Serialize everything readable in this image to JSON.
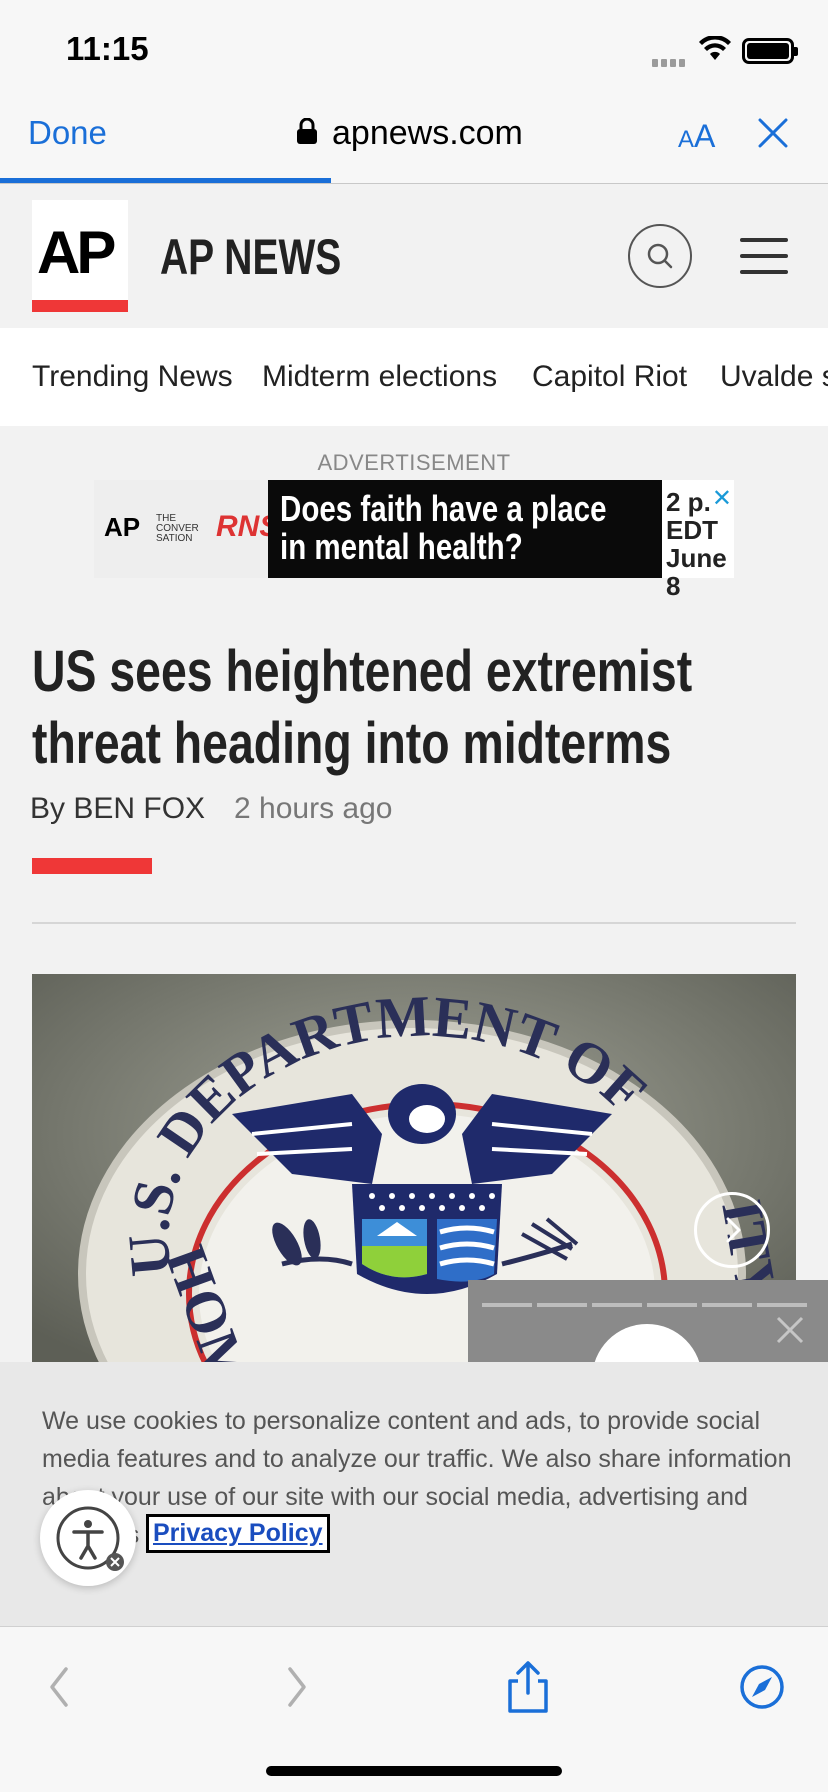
{
  "status_bar": {
    "time": "11:15"
  },
  "browser": {
    "done_label": "Done",
    "url": "apnews.com",
    "text_size_small": "A",
    "text_size_big": "A"
  },
  "site": {
    "logo_text": "AP",
    "brand": "AP NEWS"
  },
  "nav": {
    "items": [
      "Trending News",
      "Midterm elections",
      "Capitol Riot",
      "Uvalde s"
    ]
  },
  "ad": {
    "label": "ADVERTISEMENT",
    "logo_ap": "AP",
    "logo_conversation": "THE CONVER SATION",
    "logo_rns": "RNS",
    "headline_line1": "Does faith have a place",
    "headline_line2": "in mental health?",
    "time_line1": "2 p.",
    "time_line2": "EDT",
    "time_line3": "June 8",
    "close": "✕"
  },
  "article": {
    "headline": "US sees heightened extremist threat heading into midterms",
    "byline": "By BEN FOX",
    "time_ago": "2 hours ago"
  },
  "image": {
    "seal_text_top": "U.S. DEPARTMENT OF",
    "seal_text_bottom": "HOME",
    "seal_text_right": "ITY"
  },
  "cookie": {
    "text": "We use cookies to personalize content and ads, to provide social media features and to analyze our traffic. We also share information about your use of our site with our social media, advertising and analytics",
    "privacy_label": "Privacy Policy"
  },
  "colors": {
    "accent_blue": "#1a6fd8",
    "ap_red": "#ef3737"
  }
}
